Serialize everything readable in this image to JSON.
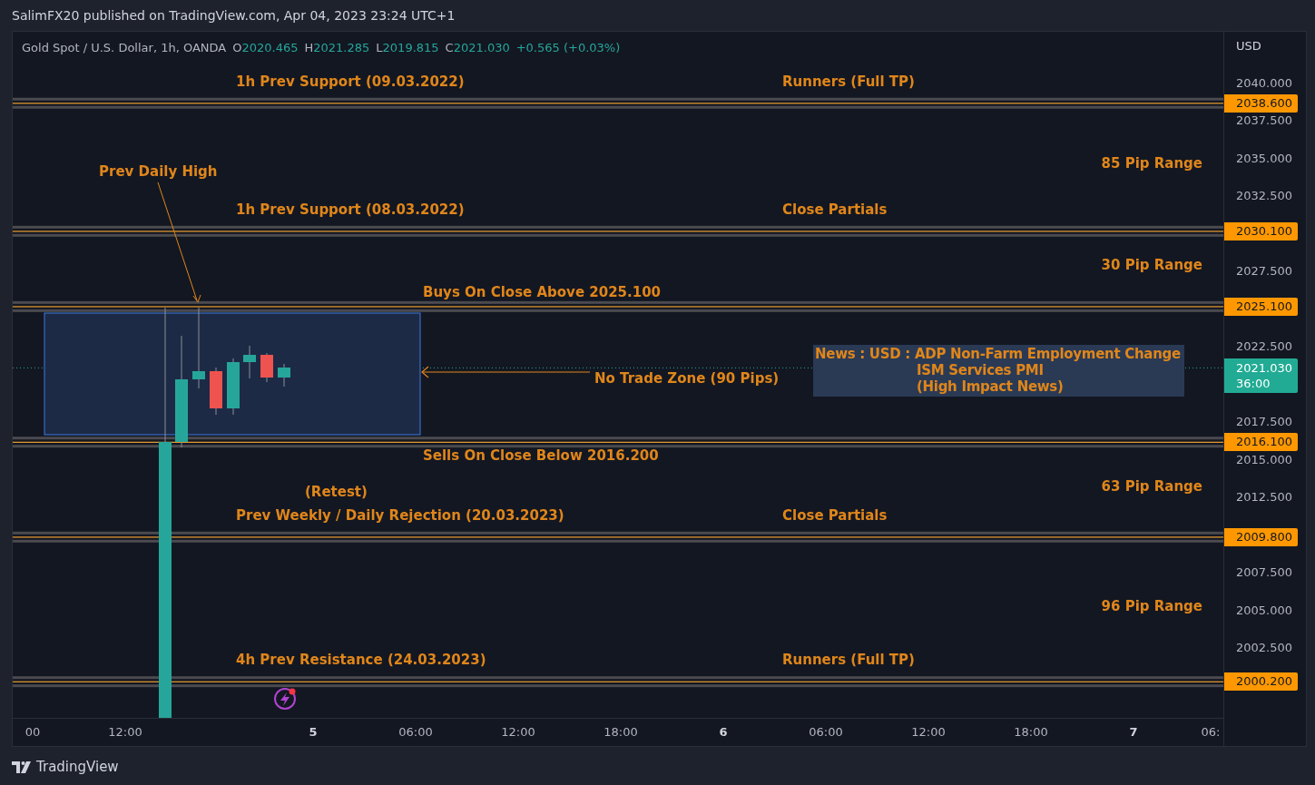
{
  "header": {
    "text": "SalimFX20 published on TradingView.com, Apr 04, 2023 23:24 UTC+1"
  },
  "legend": {
    "symbol": "Gold Spot / U.S. Dollar, 1h, OANDA",
    "ohlc": [
      {
        "key": "O",
        "value": "2020.465"
      },
      {
        "key": "H",
        "value": "2021.285"
      },
      {
        "key": "L",
        "value": "2019.815"
      },
      {
        "key": "C",
        "value": "2021.030"
      }
    ],
    "change": "+0.565 (+0.03%)"
  },
  "levels": [
    {
      "kind": "zone",
      "price": "2038.600",
      "label": "1h Prev Support (09.03.2022)",
      "note": "Runners (Full TP)"
    },
    {
      "kind": "zone",
      "price": "2030.100",
      "label": "1h Prev Support (08.03.2022)",
      "note": "Close Partials"
    },
    {
      "kind": "buy_trigger",
      "price": "2025.100",
      "label": "Buys On Close Above 2025.100"
    },
    {
      "kind": "sell_trigger",
      "price": "2016.100",
      "label": "Sells On Close Below 2016.200"
    },
    {
      "kind": "zone",
      "price": "2009.800",
      "label": "Prev Weekly / Daily Rejection (20.03.2023)",
      "note": "Close Partials"
    },
    {
      "kind": "zone",
      "price": "2000.200",
      "label": "4h Prev Resistance (24.03.2023)",
      "note": "Runners (Full TP)"
    }
  ],
  "ranges": [
    "85 Pip Range",
    "30 Pip Range",
    "63 Pip Range",
    "96 Pip Range"
  ],
  "annotations": {
    "prev_high": "Prev Daily High",
    "retest": "(Retest)",
    "no_trade_zone": "No Trade Zone (90 Pips)"
  },
  "news": [
    "News : USD : ADP Non-Farm Employment  Change",
    "ISM Services PMI",
    "(High Impact News)"
  ],
  "price_axis": {
    "currency": "USD",
    "ticks": [
      "2040.000",
      "2037.500",
      "2035.000",
      "2032.500",
      "2027.500",
      "2022.500",
      "2017.500",
      "2015.000",
      "2012.500",
      "2007.500",
      "2005.000",
      "2002.500"
    ],
    "current": {
      "price": "2021.030",
      "countdown": "36:00"
    }
  },
  "time_axis": [
    {
      "label": "00",
      "kind": "time"
    },
    {
      "label": "12:00",
      "kind": "time"
    },
    {
      "label": "5",
      "kind": "day"
    },
    {
      "label": "06:00",
      "kind": "time"
    },
    {
      "label": "12:00",
      "kind": "time"
    },
    {
      "label": "18:00",
      "kind": "time"
    },
    {
      "label": "6",
      "kind": "day"
    },
    {
      "label": "06:00",
      "kind": "time"
    },
    {
      "label": "12:00",
      "kind": "time"
    },
    {
      "label": "18:00",
      "kind": "time"
    },
    {
      "label": "7",
      "kind": "day"
    },
    {
      "label": "06:",
      "kind": "time"
    }
  ],
  "footer": {
    "brand": "TradingView"
  }
}
